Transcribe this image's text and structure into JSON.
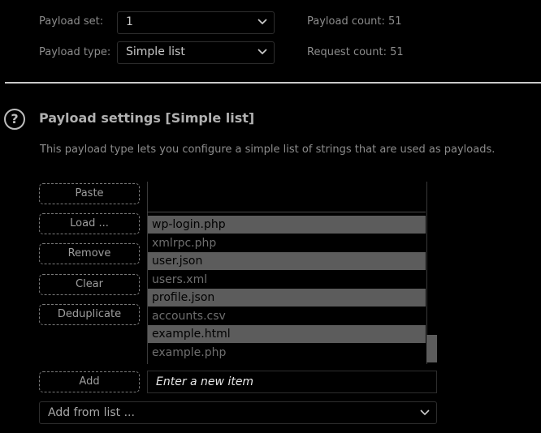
{
  "payload_set": {
    "label": "Payload set:",
    "value": "1"
  },
  "payload_type": {
    "label": "Payload type:",
    "value": "Simple list"
  },
  "payload_count": "Payload count: 51",
  "request_count": "Request count: 51",
  "section": {
    "title": "Payload settings [Simple list]",
    "help_glyph": "?",
    "description": "This payload type lets you configure a simple list of strings that are used as payloads."
  },
  "buttons": {
    "paste": "Paste",
    "load": "Load ...",
    "remove": "Remove",
    "clear": "Clear",
    "deduplicate": "Deduplicate",
    "add": "Add"
  },
  "list_items": [
    {
      "text": "wp-login.php",
      "selected": true
    },
    {
      "text": "xmlrpc.php",
      "selected": false
    },
    {
      "text": "user.json",
      "selected": true
    },
    {
      "text": "users.xml",
      "selected": false
    },
    {
      "text": "profile.json",
      "selected": true
    },
    {
      "text": "accounts.csv",
      "selected": false
    },
    {
      "text": "example.html",
      "selected": true
    },
    {
      "text": "example.php",
      "selected": false
    }
  ],
  "new_item_placeholder": "Enter a new item",
  "add_from_list": "Add from list ...",
  "icons": {
    "dropdown": "chevron-down-icon",
    "help": "help-icon"
  }
}
